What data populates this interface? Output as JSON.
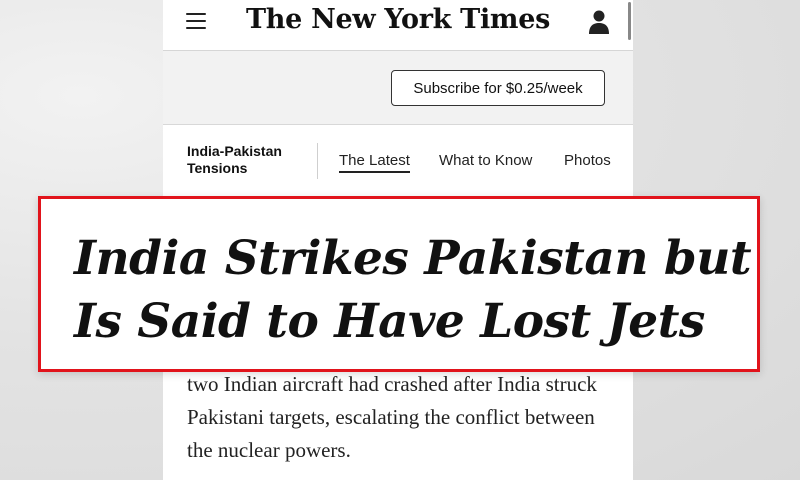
{
  "header": {
    "logo_text": "The New York Times",
    "menu_icon": "hamburger-menu-icon",
    "account_icon": "user-account-icon"
  },
  "subscribe": {
    "label": "Subscribe for $0.25/week"
  },
  "nav": {
    "section": "India-Pakistan Tensions",
    "tabs": [
      {
        "label": "The Latest",
        "active": true
      },
      {
        "label": "What to Know",
        "active": false
      },
      {
        "label": "Photos",
        "active": false
      }
    ]
  },
  "headline": {
    "text": "India Strikes Pakistan but Is Said to Have Lost Jets"
  },
  "article": {
    "summary_fragment": "two Indian aircraft had crashed after India struck Pakistani targets, escalating the conflict between the nuclear powers."
  },
  "colors": {
    "highlight_border": "#e1131b",
    "text": "#111111"
  }
}
